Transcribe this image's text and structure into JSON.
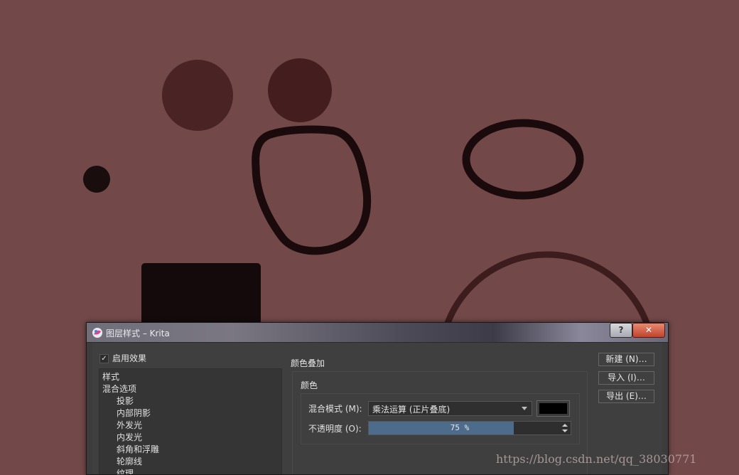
{
  "window": {
    "title": "图层样式 – Krita"
  },
  "titlebar": {
    "help_label": "?",
    "close_label": "✕"
  },
  "colors": {
    "canvas_bg": "#724849",
    "accent": "#4d6c8c",
    "swatch": "#000000"
  },
  "enable_effects": {
    "label": "启用效果",
    "checked": true
  },
  "styles_list": {
    "items": [
      "样式",
      "混合选项",
      "投影",
      "内部阴影",
      "外发光",
      "内发光",
      "斜角和浮雕",
      "轮廓线",
      "纹理"
    ]
  },
  "color_overlay": {
    "section_title": "颜色叠加",
    "group_title": "颜色",
    "blend_mode_label": "混合模式 (M):",
    "blend_mode_value": "乘法运算 (正片叠底)",
    "opacity_label": "不透明度 (O):",
    "opacity_text": "75 %",
    "opacity_fraction": 0.75
  },
  "buttons": {
    "new": "新建 (N)…",
    "import": "导入 (I)…",
    "export": "导出 (E)…"
  },
  "watermark": "https://blog.csdn.net/qq_38030771"
}
